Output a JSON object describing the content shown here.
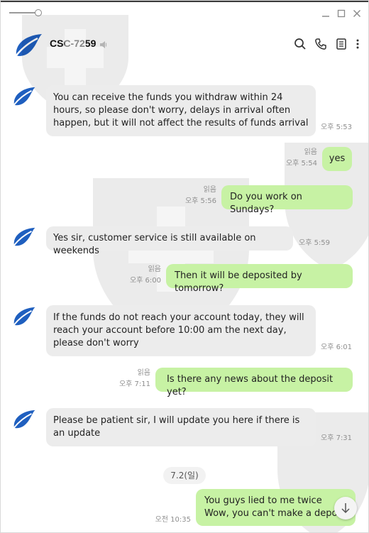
{
  "header": {
    "title": "CSC-7259"
  },
  "messages": [
    {
      "side": "in",
      "text": "You can receive the funds you withdraw within 24 hours, so please don't worry, delays in arrival often happen, but it will not affect the results of funds arrival",
      "time": "오후 5:53"
    },
    {
      "side": "out",
      "text": "yes",
      "read": "읽음",
      "time": "오후 5:54"
    },
    {
      "side": "out",
      "text": "Do you work on Sundays?",
      "read": "읽음",
      "time": "오후 5:56"
    },
    {
      "side": "in",
      "text": "Yes sir, customer service is still available on weekends",
      "time": "오후 5:59"
    },
    {
      "side": "out",
      "text": "Then it will be deposited by tomorrow?",
      "read": "읽음",
      "time": "오후 6:00"
    },
    {
      "side": "in",
      "text": "If the funds do not reach your account today, they will reach your account before 10:00 am the next day, please don't worry",
      "time": "오후 6:01"
    },
    {
      "side": "out",
      "text": "Is there any news about the deposit yet?",
      "read": "읽음",
      "time": "오후 7:11"
    },
    {
      "side": "in",
      "text": "Please be patient sir, I will update you here if there is an update",
      "time": "오후 7:31"
    },
    {
      "side": "out",
      "text": "You guys lied to me twice\nWow, you can't make a deposi",
      "time": "오전 10:35"
    }
  ],
  "date_divider": "7.2(일)",
  "colors": {
    "incoming": "#ececec",
    "outgoing": "#c7f2a4",
    "logo": "#1f5fbf"
  },
  "icons": [
    "minimize-icon",
    "maximize-icon",
    "close-icon",
    "mute-icon",
    "search-icon",
    "phone-icon",
    "menu-icon",
    "more-icon",
    "scroll-down-icon"
  ]
}
